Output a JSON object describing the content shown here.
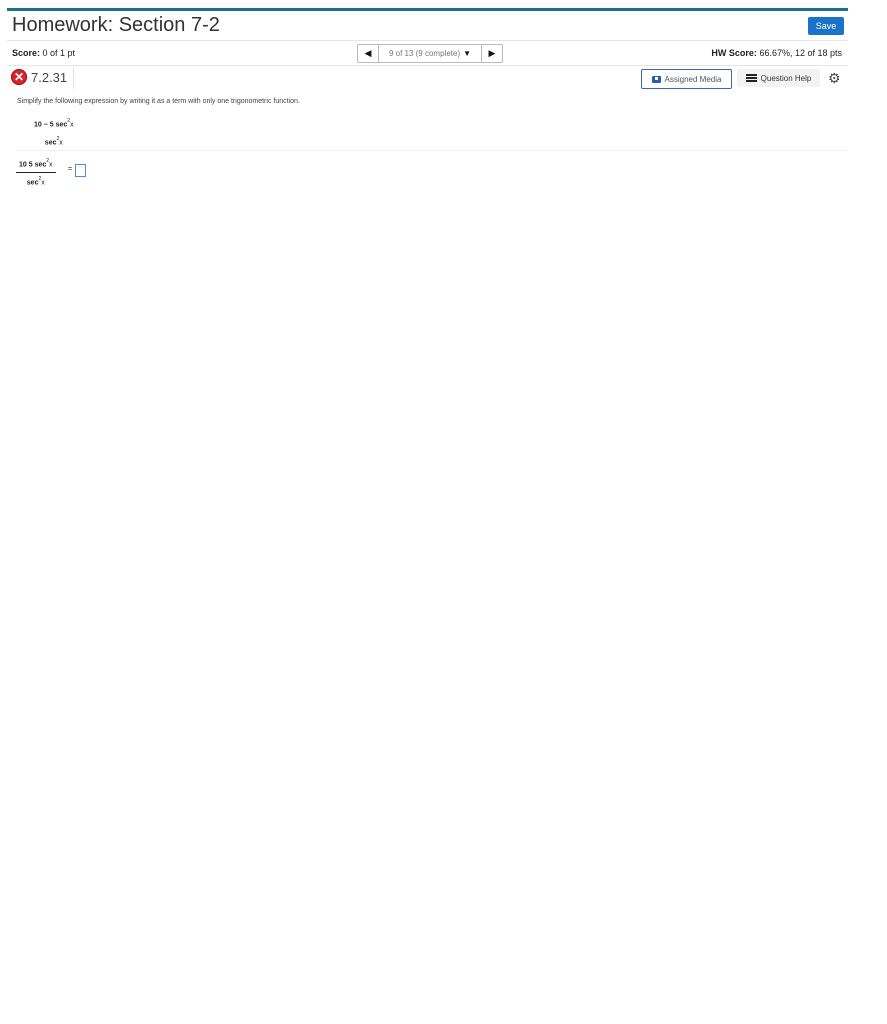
{
  "header": {
    "title": "Homework: Section 7-2",
    "save_label": "Save"
  },
  "status": {
    "score_label": "Score:",
    "score_value": "0 of 1 pt",
    "hw_score_label": "HW Score:",
    "hw_score_value": "66.67%, 12 of 18 pts"
  },
  "nav": {
    "position_text": "9 of 13 (9 complete)",
    "prev_icon": "triangle-left-icon",
    "next_icon": "triangle-right-icon"
  },
  "question": {
    "id": "7.2.31",
    "status_icon": "incorrect-x-icon",
    "assigned_media_label": "Assigned Media",
    "question_help_label": "Question Help",
    "settings_icon": "gear-icon",
    "instruction": "Simplify the following expression by writing it as a term with only one trigonometric function.",
    "expression": {
      "numerator_prefix": "10 − 5 sec",
      "numerator_exp": "2",
      "numerator_suffix": "x",
      "denominator_prefix": "sec",
      "denominator_exp": "2",
      "denominator_suffix": "x"
    },
    "answer_expression": {
      "numerator_prefix": "10   5 sec",
      "numerator_exp": "2",
      "numerator_suffix": "x",
      "denominator_prefix": "sec",
      "denominator_exp": "2",
      "denominator_suffix": "x",
      "equals": "="
    }
  },
  "colors": {
    "accent_bar": "#1b6f86",
    "save_button": "#1a73c8",
    "incorrect": "#d8242b",
    "input_border": "#4a90d9"
  }
}
